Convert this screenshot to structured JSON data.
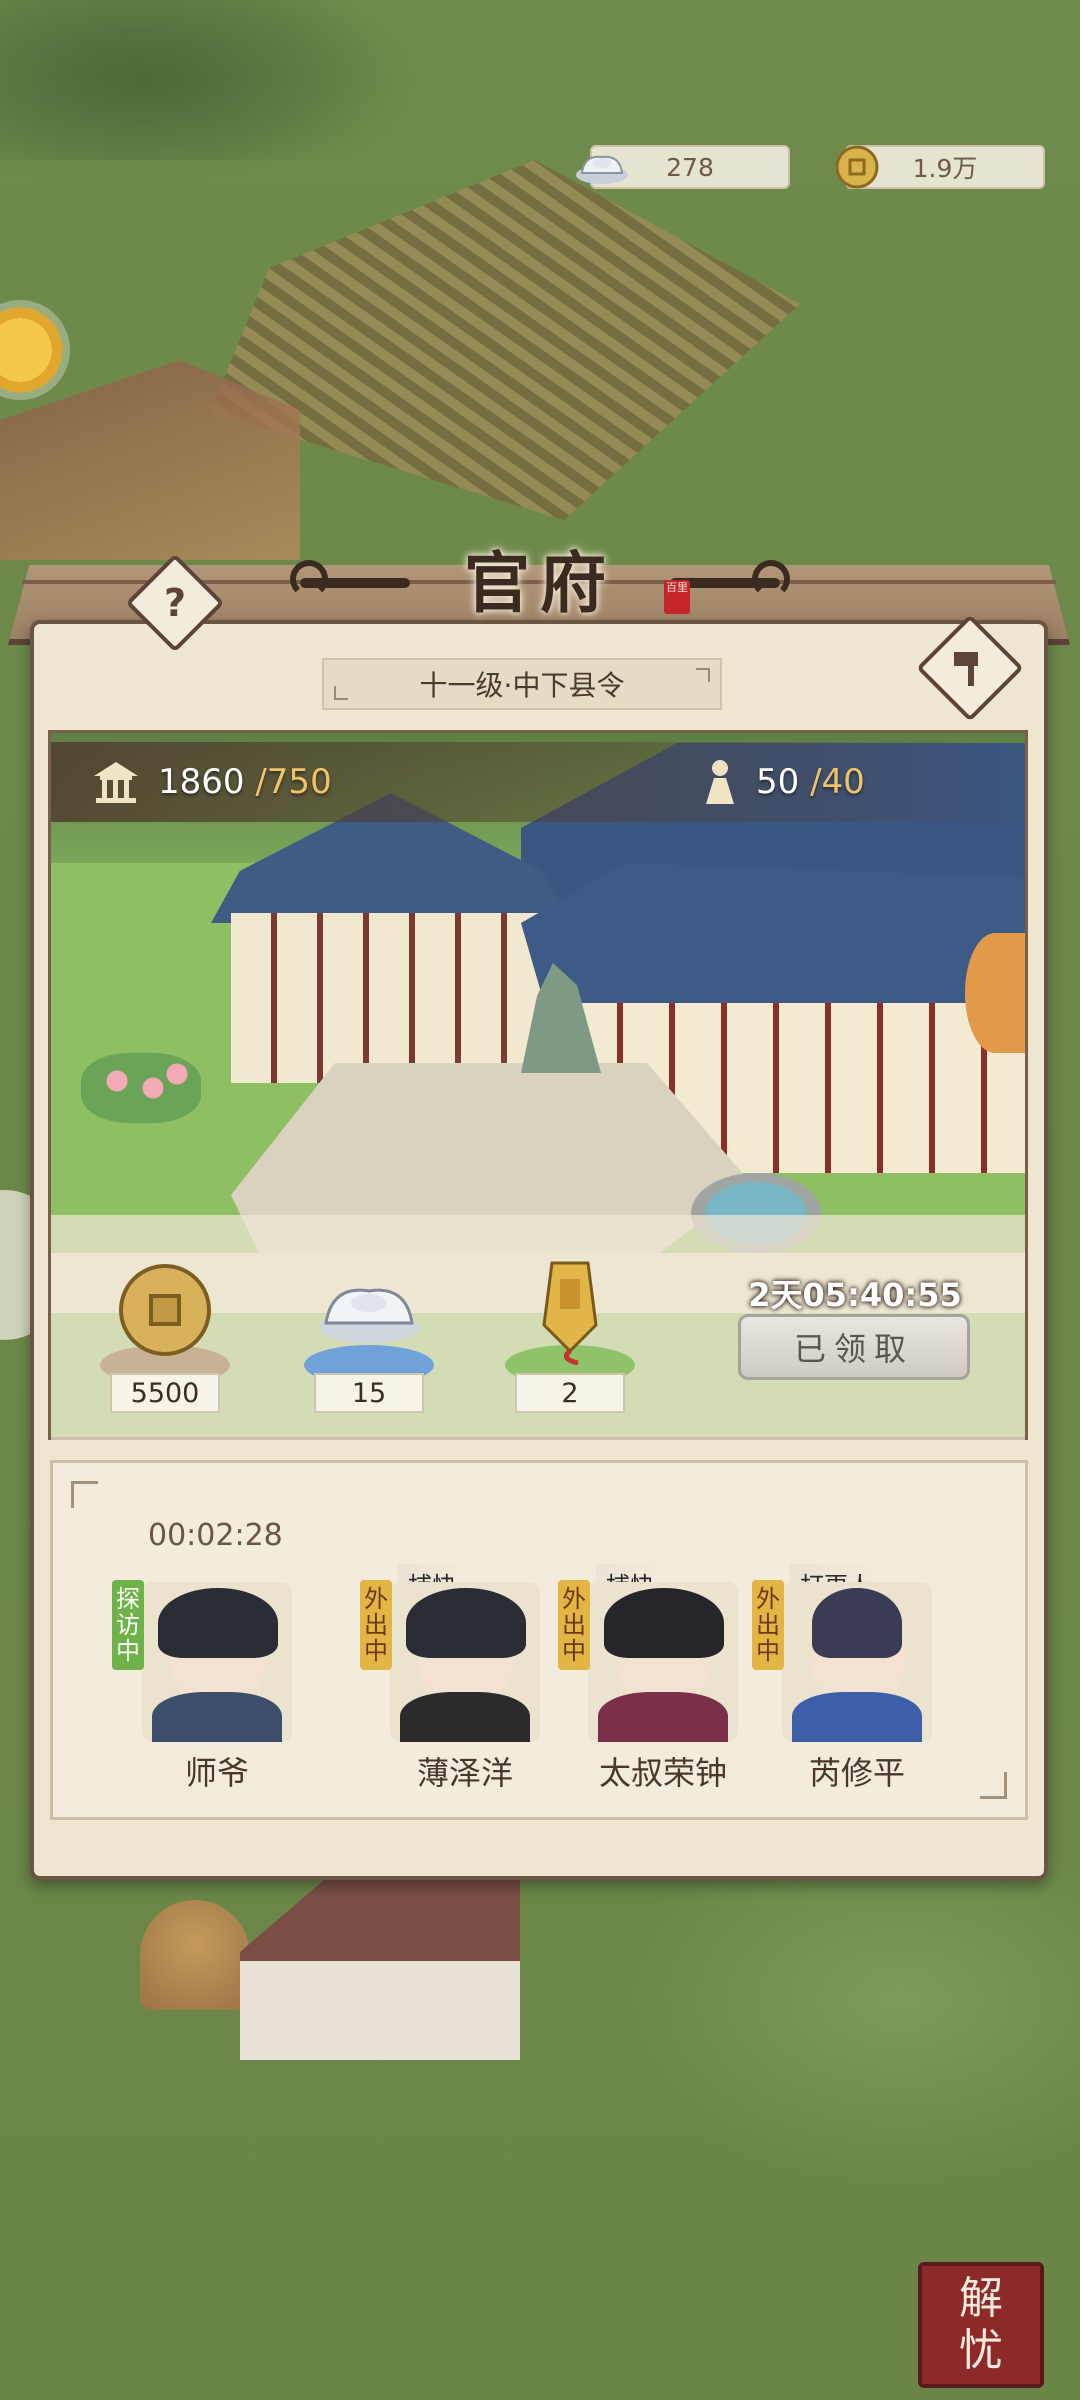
{
  "currency": {
    "silver": "278",
    "coins": "1.9万"
  },
  "panel": {
    "title": "官府",
    "seal_text": "百里",
    "rank": "十一级·中下县令",
    "help_label": "?",
    "prosperity": {
      "current": "1860",
      "max": "/750"
    },
    "population": {
      "current": "50",
      "max": "/40"
    }
  },
  "rewards": [
    {
      "icon": "copper-coin-icon",
      "count": "5500"
    },
    {
      "icon": "silver-ingot-icon",
      "count": "15"
    },
    {
      "icon": "token-icon",
      "count": "2"
    }
  ],
  "timer": "2天05:40:55",
  "claim_button": "已领取",
  "visit_timer": "00:02:28",
  "staff": [
    {
      "name": "师爷",
      "status": "探访中",
      "role": ""
    },
    {
      "name": "薄泽洋",
      "status": "外出中",
      "role": "捕快"
    },
    {
      "name": "太叔荣钟",
      "status": "外出中",
      "role": "捕快"
    },
    {
      "name": "芮修平",
      "status": "外出中",
      "role": "打更人"
    }
  ],
  "corner_button": {
    "line1": "解",
    "line2": "忧"
  },
  "colors": {
    "panel_bg": "#efe6d2",
    "frame": "#6a5444",
    "visiting_tag": "#6fb24a",
    "out_tag": "#e3b544",
    "corner_button": "#8c2a2a"
  }
}
